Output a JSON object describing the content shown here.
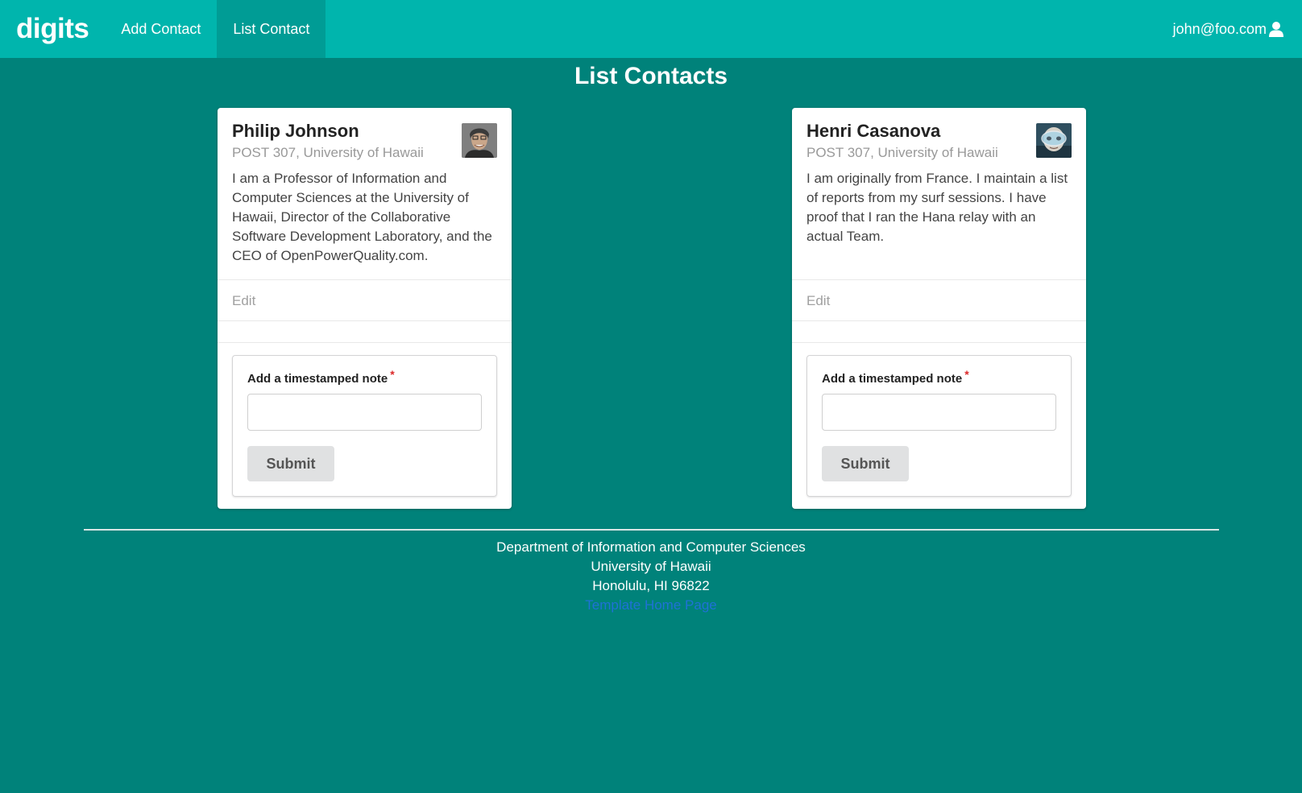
{
  "nav": {
    "brand": "digits",
    "items": [
      {
        "label": "Add Contact"
      },
      {
        "label": "List Contact"
      }
    ],
    "user_email": "john@foo.com"
  },
  "page": {
    "title": "List Contacts"
  },
  "contacts": [
    {
      "name": "Philip Johnson",
      "address": "POST 307, University of Hawaii",
      "description": "I am a Professor of Information and Computer Sciences at the University of Hawaii, Director of the Collaborative Software Development Laboratory, and the CEO of OpenPowerQuality.com.",
      "edit_label": "Edit",
      "note_label": "Add a timestamped note",
      "note_required": "*",
      "note_value": "",
      "submit_label": "Submit"
    },
    {
      "name": "Henri Casanova",
      "address": "POST 307, University of Hawaii",
      "description": "I am originally from France. I maintain a list of reports from my surf sessions. I have proof that I ran the Hana relay with an actual Team.",
      "edit_label": "Edit",
      "note_label": "Add a timestamped note",
      "note_required": "*",
      "note_value": "",
      "submit_label": "Submit"
    }
  ],
  "footer": {
    "line1": "Department of Information and Computer Sciences",
    "line2": "University of Hawaii",
    "line3": "Honolulu, HI 96822",
    "link": "Template Home Page"
  }
}
